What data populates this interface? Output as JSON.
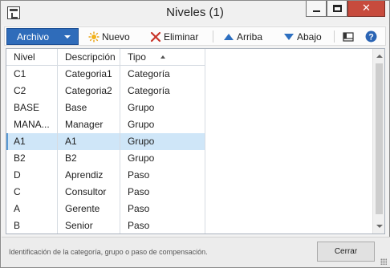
{
  "window": {
    "title": "Niveles (1)"
  },
  "toolbar": {
    "archivo_label": "Archivo",
    "nuevo_label": "Nuevo",
    "eliminar_label": "Eliminar",
    "arriba_label": "Arriba",
    "abajo_label": "Abajo"
  },
  "grid": {
    "columns": [
      "Nivel",
      "Descripción",
      "Tipo"
    ],
    "rows": [
      [
        "C1",
        "Categoria1",
        "Categoría"
      ],
      [
        "C2",
        "Categoria2",
        "Categoría"
      ],
      [
        "BASE",
        "Base",
        "Grupo"
      ],
      [
        "MANA...",
        "Manager",
        "Grupo"
      ],
      [
        "A1",
        "A1",
        "Grupo"
      ],
      [
        "B2",
        "B2",
        "Grupo"
      ],
      [
        "D",
        "Aprendiz",
        "Paso"
      ],
      [
        "C",
        "Consultor",
        "Paso"
      ],
      [
        "A",
        "Gerente",
        "Paso"
      ],
      [
        "B",
        "Senior",
        "Paso"
      ]
    ],
    "selected_row_index": 4
  },
  "footer": {
    "status_text": "Identificación de la categoría, grupo o paso de compensación.",
    "close_label": "Cerrar"
  },
  "colors": {
    "accent": "#2f6cba",
    "close_button": "#c74b3d",
    "selection": "#cfe6f8"
  }
}
